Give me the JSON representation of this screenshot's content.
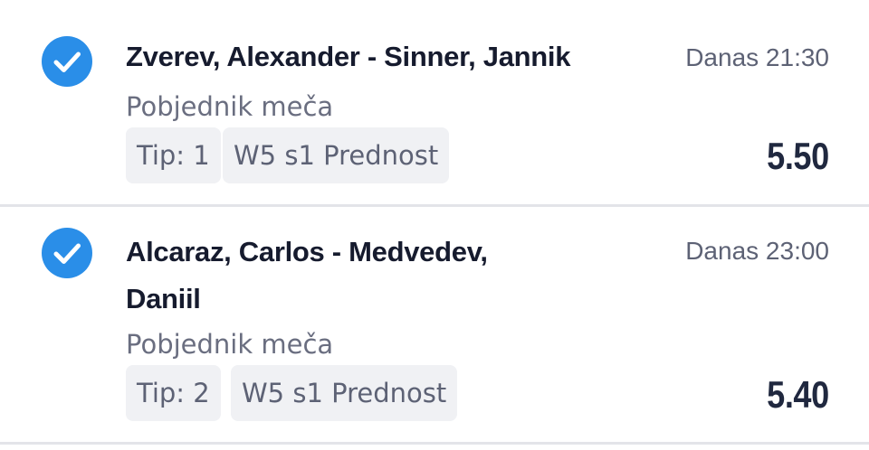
{
  "bets": [
    {
      "match": "Zverev, Alexander - Sinner, Jannik",
      "time": "Danas 21:30",
      "market": "Pobjednik meča",
      "tip": "Tip: 1",
      "bonus": "W5 s1 Prednost",
      "odds": "5.50",
      "checked": true
    },
    {
      "match_line1": "Alcaraz, Carlos - Medvedev,",
      "match_line2": "Daniil",
      "time": "Danas 23:00",
      "market": "Pobjednik meča",
      "tip": "Tip: 2",
      "bonus": "W5 s1 Prednost",
      "odds": "5.40",
      "checked": true
    }
  ],
  "colors": {
    "check_blue": "#2a8ee8",
    "title": "#161b2e",
    "muted": "#5d6275",
    "chip_bg": "#f0f1f4",
    "divider": "#e3e4e9"
  },
  "icons": {
    "checked": "check-circle-icon"
  }
}
